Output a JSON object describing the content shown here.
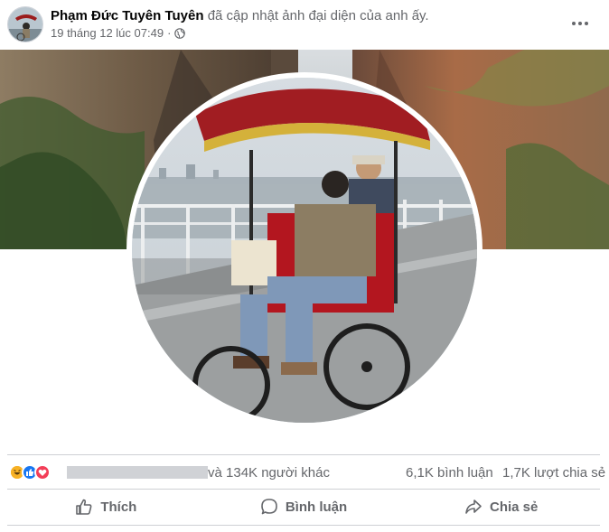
{
  "post": {
    "author_name": "Phạm Đức Tuyên Tuyên",
    "action_text": "đã cập nhật ảnh đại diện của anh ấy.",
    "timestamp": "19 tháng 12 lúc 07:49",
    "separator": "·",
    "privacy_icon": "globe-icon",
    "more_icon": "more-options-icon"
  },
  "reactions": {
    "icons": [
      "haha",
      "like",
      "love"
    ],
    "summary": "và 134K người khác",
    "comments": "6,1K bình luận",
    "shares": "1,7K lượt chia sẻ"
  },
  "actions": {
    "like_label": "Thích",
    "comment_label": "Bình luận",
    "share_label": "Chia sẻ"
  },
  "colors": {
    "secondary_text": "#65676b",
    "like_blue": "#1877f2",
    "love_red": "#f33e58",
    "haha_yellow": "#f7b125",
    "divider": "#ced0d4"
  }
}
